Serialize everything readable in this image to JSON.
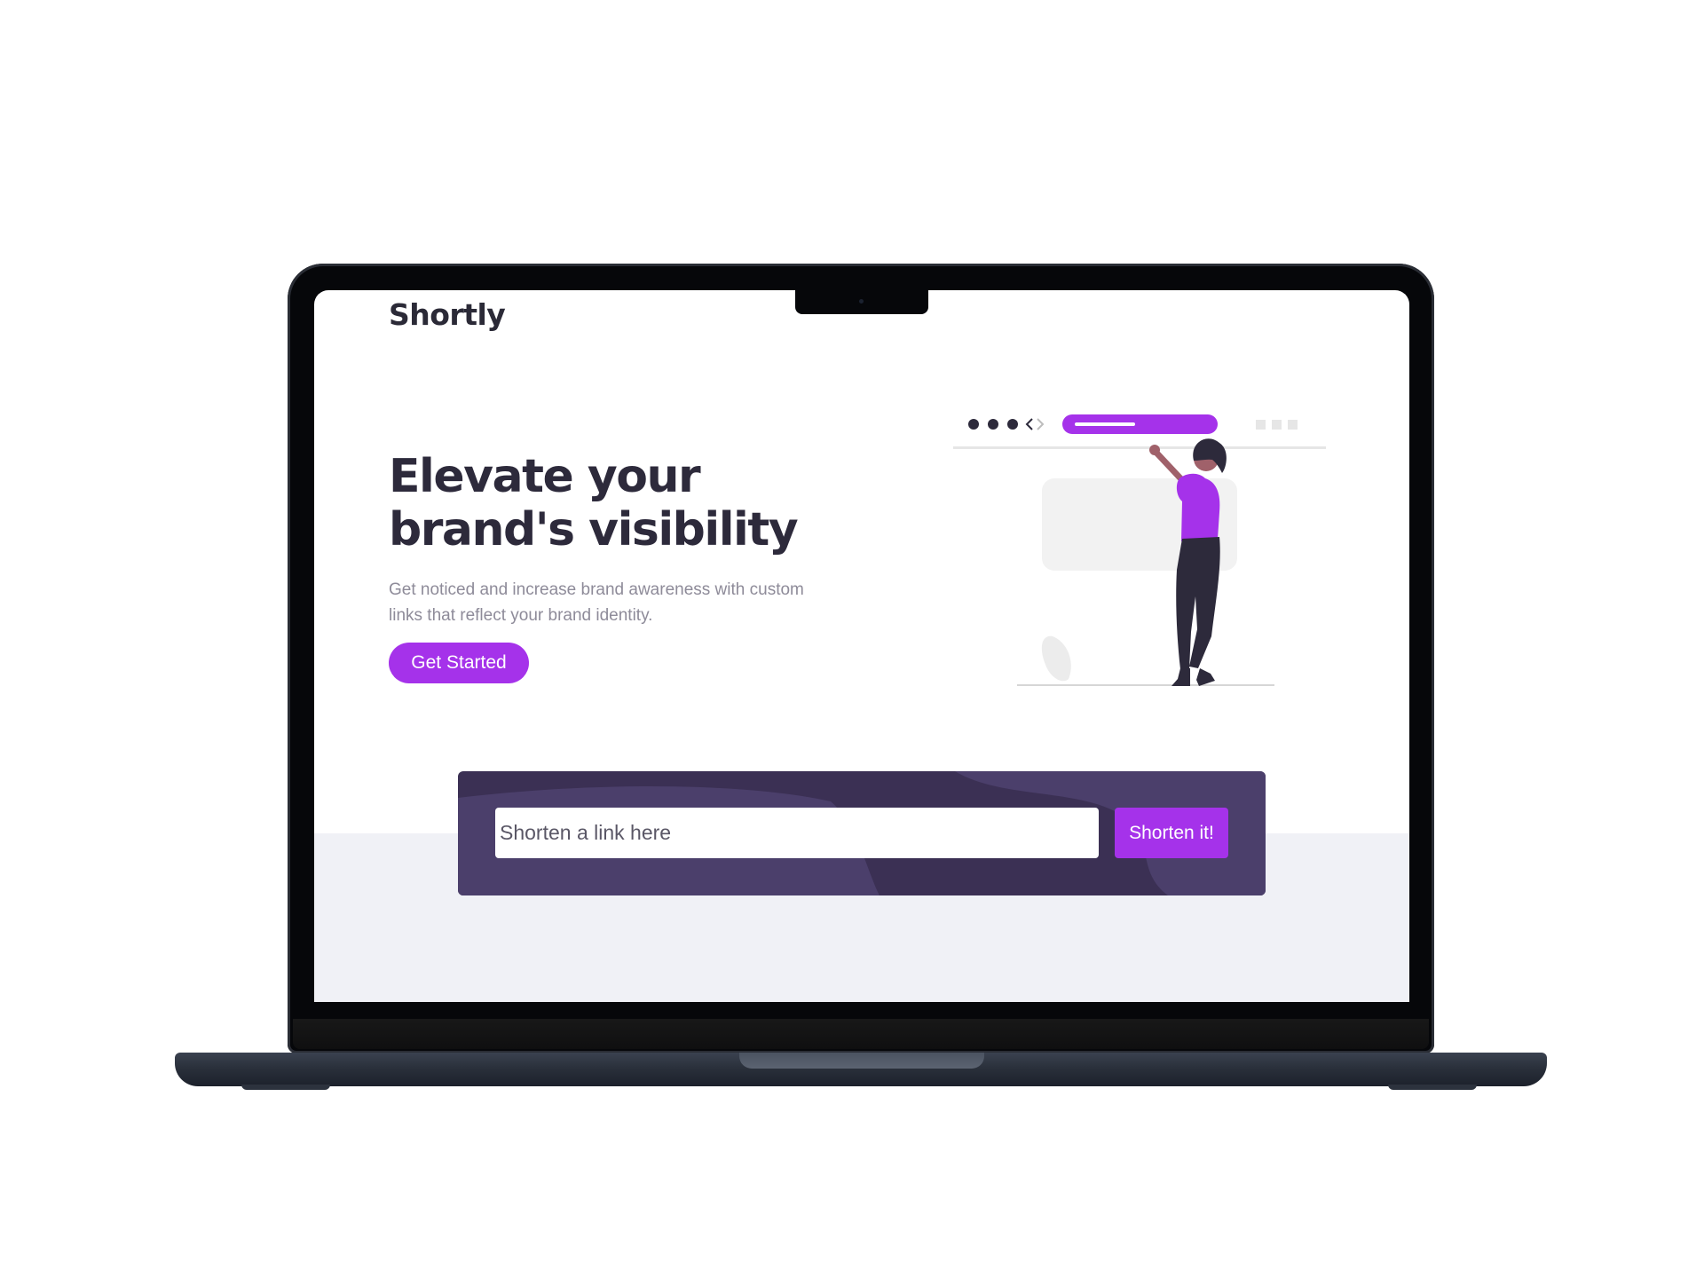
{
  "site": {
    "logo": "Shortly"
  },
  "hero": {
    "title": "Elevate your brand's visibility",
    "description": "Get noticed and increase brand awareness with custom links that reflect your brand identity.",
    "cta_label": "Get Started"
  },
  "shortener": {
    "placeholder": "Shorten a link here",
    "button_label": "Shorten it!"
  },
  "colors": {
    "accent": "#a532ea",
    "dark_text": "#2d2a3b",
    "muted_text": "#8e8b99",
    "shortener_bg": "#3b3054",
    "lower_band": "#f0f1f6"
  }
}
